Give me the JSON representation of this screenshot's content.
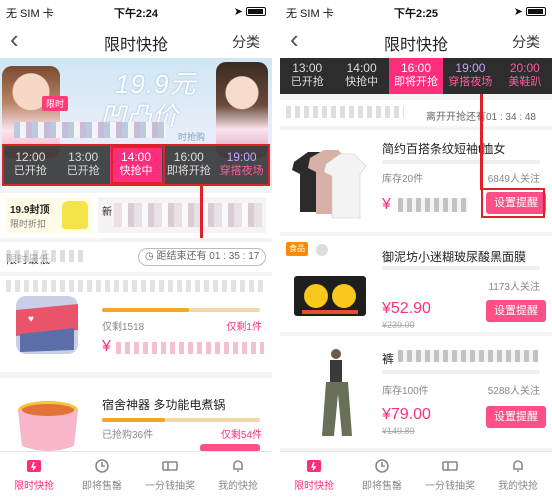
{
  "left": {
    "status": {
      "carrier": "无 SIM 卡",
      "time": "下午2:24"
    },
    "nav": {
      "title": "限时快抢",
      "right": "分类"
    },
    "banner": {
      "badge": "限时",
      "headline": "19.9元",
      "subline": "凹凸价",
      "link": "时抢购"
    },
    "tabs": [
      {
        "time": "12:00",
        "label": "已开抢"
      },
      {
        "time": "13:00",
        "label": "已开抢"
      },
      {
        "time": "14:00",
        "label": "快抢中"
      },
      {
        "time": "16:00",
        "label": "即将开抢"
      },
      {
        "time": "19:00",
        "label": "穿搭夜场"
      }
    ],
    "promo": {
      "card1_title": "19.9封顶",
      "card1_sub": "限时折扣",
      "card2_title": "新"
    },
    "countdown": {
      "label": "限时最低",
      "timer": "01 : 35 : 17",
      "timer_prefix": "距结束还有"
    },
    "products": [
      {
        "title": "",
        "sold": "仅剩1518",
        "left_text": "仅剩1件",
        "price": "¥"
      },
      {
        "title": "宿舍神器 多功能电煮锅",
        "sold": "已抢购36件",
        "left_text": "仅剩54件"
      }
    ]
  },
  "right": {
    "status": {
      "carrier": "无 SIM 卡",
      "time": "下午2:25"
    },
    "nav": {
      "title": "限时快抢",
      "right": "分类"
    },
    "tabs": [
      {
        "time": "13:00",
        "label": "已开抢"
      },
      {
        "time": "14:00",
        "label": "快抢中"
      },
      {
        "time": "16:00",
        "label": "即将开抢"
      },
      {
        "time": "19:00",
        "label": "穿搭夜场"
      },
      {
        "time": "20:00",
        "label": "美鞋趴"
      }
    ],
    "info": {
      "timer_prefix": "离开开抢还有",
      "timer": "01 : 34 : 48"
    },
    "products": [
      {
        "title": "简约百搭条纹短袖t恤女",
        "stock": "库存20件",
        "fav": "6849人关注",
        "price": "¥",
        "button": "设置提醒"
      },
      {
        "tag": "食品",
        "title": "御泥坊小迷糊玻尿酸黑面膜",
        "fav": "1173人关注",
        "price": "¥52.90",
        "old_price": "¥239.00",
        "button": "设置提醒"
      },
      {
        "title": "裤",
        "stock": "库存100件",
        "fav": "5288人关注",
        "price": "¥79.00",
        "old_price": "¥149.89",
        "button": "设置提醒"
      }
    ]
  },
  "tabbar": [
    {
      "label": "限时快抢",
      "icon": "flash-sale-icon"
    },
    {
      "label": "即将售罄",
      "icon": "clock-icon"
    },
    {
      "label": "一分钱抽奖",
      "icon": "ticket-icon"
    },
    {
      "label": "我的快抢",
      "icon": "bell-icon"
    }
  ],
  "colors": {
    "accent": "#ff2e7d",
    "annotation": "#e0202b",
    "tab_bg": "#2d2d2d"
  }
}
